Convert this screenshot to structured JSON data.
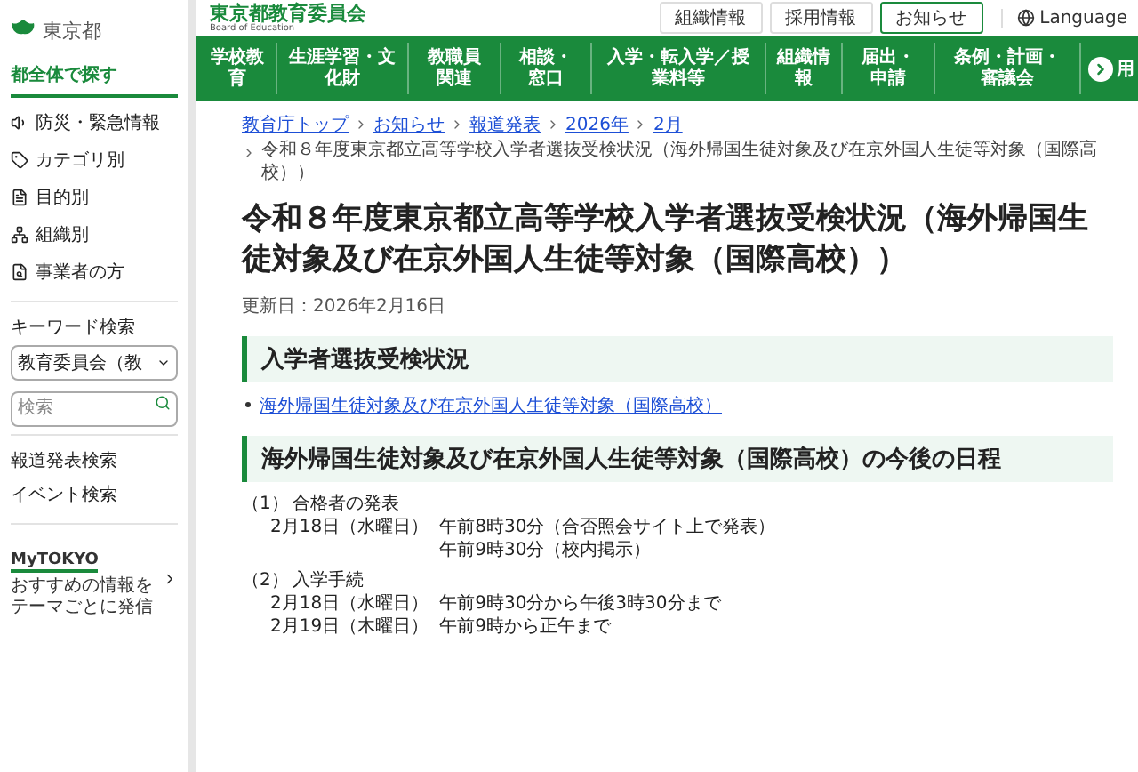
{
  "sidebar": {
    "logo": "東京都",
    "section_title": "都全体で探す",
    "items": [
      {
        "label": "防災・緊急情報",
        "kind": "alert"
      },
      {
        "label": "カテゴリ別",
        "kind": "category"
      },
      {
        "label": "目的別",
        "kind": "purpose"
      },
      {
        "label": "組織別",
        "kind": "organization"
      },
      {
        "label": "事業者の方",
        "kind": "business"
      }
    ],
    "keyword_title": "キーワード検索",
    "select_value": "教育委員会（教",
    "search": {
      "placeholder": "検索"
    },
    "links": [
      "報道発表検索",
      "イベント検索"
    ],
    "mytokyo": {
      "logo": "MyTOKYO",
      "lines": [
        "おすすめの情報を",
        "テーマごとに発信"
      ]
    }
  },
  "header": {
    "title": "東京都教育委員会",
    "subtitle": "Board of Education",
    "links": [
      {
        "label": "組織情報",
        "kind": "plain"
      },
      {
        "label": "採用情報",
        "kind": "plain"
      },
      {
        "label": "お知らせ",
        "kind": "accent"
      }
    ],
    "language": "Language"
  },
  "nav": {
    "items": [
      "学校教育",
      "生涯学習・文化財",
      "教職員関連",
      "相談・窓口",
      "入学・転入学／授業料等",
      "組織情報",
      "届出・申請",
      "条例・計画・審議会"
    ],
    "partial_item": "用"
  },
  "breadcrumb": {
    "links": [
      "教育庁トップ",
      "お知らせ",
      "報道発表",
      "2026年",
      "2月"
    ],
    "current": "令和８年度東京都立高等学校入学者選抜受検状況（海外帰国生徒対象及び在京外国人生徒等対象（国際高校））"
  },
  "title": "令和８年度東京都立高等学校入学者選抜受検状況（海外帰国生徒対象及び在京外国人生徒等対象（国際高校））",
  "updated": "更新日：2026年2月16日",
  "sections": [
    {
      "heading": "入学者選抜受検状況",
      "links": [
        "海外帰国生徒対象及び在京外国人生徒等対象（国際高校）"
      ]
    },
    {
      "heading": "海外帰国生徒対象及び在京外国人生徒等対象（国際高校）の今後の日程",
      "schedule": [
        {
          "number": "（1）",
          "title": "合格者の発表",
          "rows": [
            {
              "date": "2月18日（水曜日）",
              "times": [
                "午前8時30分（合否照会サイト上で発表）",
                "午前9時30分（校内掲示）"
              ]
            }
          ]
        },
        {
          "number": "（2）",
          "title": "入学手続",
          "rows": [
            {
              "date": "2月18日（水曜日）",
              "times": [
                "午前9時30分から午後3時30分まで"
              ]
            },
            {
              "date": "2月19日（木曜日）",
              "times": [
                "午前9時から正午まで"
              ]
            }
          ]
        }
      ]
    }
  ]
}
